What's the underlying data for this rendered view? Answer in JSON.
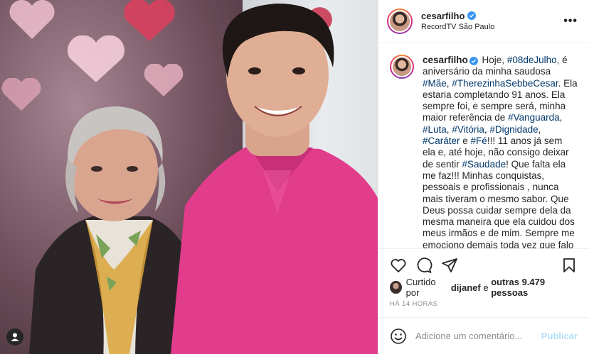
{
  "post": {
    "username": "cesarfilho",
    "location": "RecordTV São Paulo",
    "more_label": "•••"
  },
  "caption": {
    "username": "cesarfilho",
    "parts": [
      {
        "t": "Hoje, ",
        "tag": false
      },
      {
        "t": "#08deJulho",
        "tag": true
      },
      {
        "t": ", é aniversário da minha saudosa ",
        "tag": false
      },
      {
        "t": "#Mãe",
        "tag": true
      },
      {
        "t": ", ",
        "tag": false
      },
      {
        "t": "#TherezinhaSebbeCesar",
        "tag": true
      },
      {
        "t": ". Ela estaria completando 91 anos. Ela sempre foi, e sempre será, minha maior referência de ",
        "tag": false
      },
      {
        "t": "#Vanguarda",
        "tag": true
      },
      {
        "t": ", ",
        "tag": false
      },
      {
        "t": "#Luta",
        "tag": true
      },
      {
        "t": ", ",
        "tag": false
      },
      {
        "t": "#Vitória",
        "tag": true
      },
      {
        "t": ", ",
        "tag": false
      },
      {
        "t": "#Dignidade",
        "tag": true
      },
      {
        "t": ", ",
        "tag": false
      },
      {
        "t": "#Caráter",
        "tag": true
      },
      {
        "t": " e ",
        "tag": false
      },
      {
        "t": "#Fé",
        "tag": true
      },
      {
        "t": "!!! 11 anos já sem ela e, até hoje, não consigo deixar de sentir ",
        "tag": false
      },
      {
        "t": "#Saudade",
        "tag": true
      },
      {
        "t": "! Que falta ela me faz!!! Minhas conquistas, pessoais e profissionais , nunca mais tiveram o mesmo sabor. Que Deus possa cuidar sempre dela da mesma maneira que ela cuidou dos meus irmãos e de mim. Sempre me emociono demais toda vez que falo ou escrevo sobre ela.",
        "tag": false
      }
    ]
  },
  "likes": {
    "prefix": "Curtido por",
    "user": "dijanef",
    "connector": "e",
    "others": "outras 9.479 pessoas"
  },
  "time": "HÁ 14 HORAS",
  "comment": {
    "placeholder": "Adicione um comentário...",
    "publish": "Publicar"
  },
  "icons": {
    "like": "heart-icon",
    "comment": "comment-icon",
    "share": "share-icon",
    "save": "bookmark-icon",
    "emoji": "emoji-icon",
    "user_tag": "user-tag-icon",
    "verified": "verified-badge-icon"
  },
  "colors": {
    "hashtag": "#00376b",
    "publish_disabled": "#b2dffc",
    "verified": "#3897f0",
    "shirt": "#e23c8c"
  }
}
